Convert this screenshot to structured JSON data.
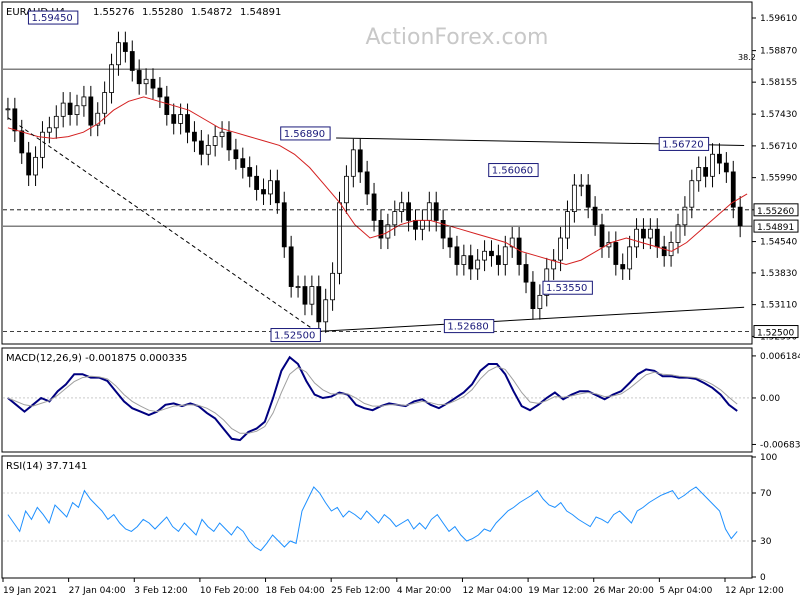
{
  "chart_data": [
    {
      "type": "candlestick",
      "header": {
        "symbol": "EURAUD,H4",
        "open": "1.55276",
        "high": "1.55280",
        "low": "1.54872",
        "close": "1.54891"
      },
      "watermark": "ActionForex.com",
      "y_axis_ticks": [
        "1.59610",
        "1.58870",
        "1.58155",
        "1.57430",
        "1.56710",
        "1.55990",
        "1.55260",
        "1.54540",
        "1.53830",
        "1.53110",
        "1.52390"
      ],
      "ylim": [
        1.5224,
        1.5995
      ],
      "price_boxes": [
        {
          "label": "1.55260",
          "value": 1.5526,
          "bg": "#ffffff",
          "fg": "#000000"
        },
        {
          "label": "1.54891",
          "value": 1.54891,
          "bg": "#ffffff",
          "fg": "#000000"
        },
        {
          "label": "1.52500",
          "value": 1.525,
          "bg": "#ffffff",
          "fg": "#000000"
        }
      ],
      "fib_label": "38.2",
      "fib_level": 1.5845,
      "annotations": [
        {
          "text": "1.59450",
          "value": 1.5945,
          "bar": 80
        },
        {
          "text": "1.56890",
          "value": 1.5689,
          "bar": 338
        },
        {
          "text": "1.56060",
          "value": 1.5606,
          "bar": 545
        },
        {
          "text": "1.56720",
          "value": 1.5672,
          "bar": 718
        },
        {
          "text": "1.53550",
          "value": 1.5355,
          "bar": 596
        },
        {
          "text": "1.52680",
          "value": 1.5268,
          "bar": 500
        },
        {
          "text": "1.52500",
          "value": 1.525,
          "bar": 318
        }
      ],
      "lines": [
        {
          "kind": "solid",
          "from": [
            338,
            1.5689
          ],
          "to": [
            752,
            1.5672
          ]
        },
        {
          "kind": "solid",
          "from": [
            318,
            1.525
          ],
          "to": [
            752,
            1.5305
          ]
        },
        {
          "kind": "dashed",
          "from": [
            5,
            1.5735
          ],
          "to": [
            318,
            1.525
          ]
        },
        {
          "kind": "dashed-h",
          "value": 1.5526
        },
        {
          "kind": "solid-h",
          "value": 1.5845
        },
        {
          "kind": "solid-h",
          "value": 1.5489
        },
        {
          "kind": "dashed-h",
          "value": 1.525
        }
      ],
      "close_series": [
        1.5755,
        1.5705,
        1.5655,
        1.5605,
        1.5645,
        1.5702,
        1.5712,
        1.5738,
        1.5768,
        1.5742,
        1.5762,
        1.5782,
        1.5718,
        1.5745,
        1.5792,
        1.5855,
        1.5905,
        1.5885,
        1.5842,
        1.5812,
        1.5822,
        1.5802,
        1.5782,
        1.5742,
        1.5722,
        1.5742,
        1.5702,
        1.5682,
        1.5652,
        1.5672,
        1.5692,
        1.5702,
        1.5662,
        1.5642,
        1.5622,
        1.5602,
        1.5572,
        1.5562,
        1.5592,
        1.5542,
        1.5442,
        1.5352,
        1.5352,
        1.5312,
        1.5352,
        1.5272,
        1.5322,
        1.5382,
        1.5542,
        1.5602,
        1.5662,
        1.5612,
        1.5562,
        1.5502,
        1.5462,
        1.5492,
        1.5522,
        1.5542,
        1.5502,
        1.5482,
        1.5502,
        1.5542,
        1.5502,
        1.5462,
        1.5442,
        1.5402,
        1.5422,
        1.5392,
        1.5412,
        1.5432,
        1.5422,
        1.5402,
        1.5442,
        1.5462,
        1.5402,
        1.5362,
        1.5302,
        1.5332,
        1.5392,
        1.5412,
        1.5462,
        1.5522,
        1.5582,
        1.5582,
        1.5532,
        1.5492,
        1.5442,
        1.5452,
        1.5402,
        1.5392,
        1.5442,
        1.5482,
        1.5462,
        1.5482,
        1.5442,
        1.5422,
        1.5452,
        1.5492,
        1.5532,
        1.5592,
        1.5622,
        1.5602,
        1.5652,
        1.5632,
        1.5612,
        1.5532,
        1.5489
      ],
      "ma_series": [
        1.5712,
        1.5702,
        1.5692,
        1.5688,
        1.5692,
        1.5702,
        1.5722,
        1.5752,
        1.5772,
        1.5782,
        1.5772,
        1.5762,
        1.5752,
        1.5732,
        1.5712,
        1.5702,
        1.5692,
        1.5682,
        1.5672,
        1.5652,
        1.5622,
        1.5582,
        1.5542,
        1.5492,
        1.5462,
        1.5472,
        1.5492,
        1.5502,
        1.5502,
        1.5492,
        1.5482,
        1.5472,
        1.5462,
        1.5452,
        1.5432,
        1.5422,
        1.5412,
        1.5402,
        1.5412,
        1.5432,
        1.5452,
        1.5462,
        1.5452,
        1.5442,
        1.5432,
        1.5452,
        1.5482,
        1.5512,
        1.5542,
        1.5562
      ],
      "ma_color": "#d42020",
      "candle_color": "#000000"
    },
    {
      "type": "line",
      "label": "MACD(12,26,9) -0.001875 0.000335",
      "y_axis_ticks": [
        "0.006184",
        "0.00",
        "-0.006837"
      ],
      "ylim": [
        -0.0078,
        0.0072
      ],
      "series": [
        {
          "role": "macd",
          "color": "#000080",
          "values": [
            0.0,
            -0.001,
            -0.002,
            -0.001,
            0.0,
            -0.0005,
            0.001,
            0.002,
            0.0035,
            0.0035,
            0.003,
            0.003,
            0.0025,
            0.001,
            -0.0005,
            -0.0015,
            -0.002,
            -0.0025,
            -0.002,
            -0.001,
            -0.0008,
            -0.0012,
            -0.0008,
            -0.0012,
            -0.0022,
            -0.003,
            -0.0045,
            -0.006,
            -0.0062,
            -0.005,
            -0.0045,
            -0.0035,
            0.0,
            0.004,
            0.006,
            0.005,
            0.0025,
            0.0005,
            0.0,
            0.0002,
            0.0008,
            0.0005,
            -0.001,
            -0.0015,
            -0.0018,
            -0.0012,
            -0.0008,
            -0.001,
            -0.0012,
            -0.0005,
            -0.0002,
            -0.001,
            -0.0015,
            -0.0008,
            0.0,
            0.0008,
            0.002,
            0.004,
            0.005,
            0.005,
            0.0035,
            0.001,
            -0.0012,
            -0.0018,
            -0.001,
            0.0,
            0.0008,
            -0.0002,
            0.0005,
            0.001,
            0.001,
            0.0004,
            -0.0002,
            0.0005,
            0.001,
            0.0022,
            0.0035,
            0.0042,
            0.004,
            0.0032,
            0.0032,
            0.003,
            0.003,
            0.0028,
            0.0022,
            0.0015,
            0.0005,
            -0.001,
            -0.0019
          ]
        },
        {
          "role": "signal",
          "color": "#a0a0a0",
          "values": [
            0.0,
            -0.0005,
            -0.001,
            -0.0012,
            -0.0008,
            -0.0004,
            0.0004,
            0.0014,
            0.0024,
            0.003,
            0.0032,
            0.0031,
            0.0028,
            0.0018,
            0.0005,
            -0.0005,
            -0.0012,
            -0.0018,
            -0.002,
            -0.0016,
            -0.0012,
            -0.0011,
            -0.001,
            -0.0011,
            -0.0015,
            -0.0022,
            -0.0032,
            -0.0045,
            -0.0052,
            -0.0052,
            -0.0049,
            -0.0042,
            -0.0022,
            0.0008,
            0.0035,
            0.0045,
            0.0038,
            0.0022,
            0.0012,
            0.0006,
            0.0006,
            0.0006,
            0.0,
            -0.0008,
            -0.0012,
            -0.0012,
            -0.001,
            -0.001,
            -0.0011,
            -0.0008,
            -0.0005,
            -0.0007,
            -0.001,
            -0.0009,
            -0.0004,
            0.0002,
            0.0012,
            0.0028,
            0.004,
            0.0046,
            0.0042,
            0.0026,
            0.0008,
            -0.0006,
            -0.0008,
            -0.0004,
            0.0002,
            0.0001,
            0.0003,
            0.0006,
            0.0008,
            0.0006,
            0.0002,
            0.0003,
            0.0006,
            0.0014,
            0.0024,
            0.0034,
            0.0038,
            0.0035,
            0.0034,
            0.0032,
            0.0031,
            0.003,
            0.0026,
            0.002,
            0.0012,
            0.0001,
            -0.0009
          ]
        }
      ]
    },
    {
      "type": "line",
      "label": "RSI(14) 37.7141",
      "y_axis_ticks": [
        "100",
        "70",
        "30",
        "0"
      ],
      "ylim": [
        0,
        100
      ],
      "guides": [
        70,
        30
      ],
      "series": [
        {
          "role": "rsi",
          "color": "#1e90ff",
          "values": [
            52,
            45,
            38,
            55,
            48,
            58,
            52,
            45,
            60,
            55,
            50,
            62,
            58,
            72,
            65,
            60,
            55,
            48,
            52,
            45,
            40,
            38,
            42,
            48,
            45,
            40,
            45,
            50,
            42,
            38,
            45,
            40,
            35,
            48,
            42,
            38,
            45,
            40,
            35,
            42,
            38,
            30,
            25,
            22,
            28,
            35,
            30,
            25,
            30,
            28,
            55,
            65,
            75,
            70,
            62,
            55,
            58,
            50,
            55,
            52,
            48,
            55,
            50,
            45,
            52,
            48,
            42,
            45,
            48,
            40,
            45,
            40,
            48,
            52,
            45,
            38,
            42,
            35,
            30,
            32,
            35,
            40,
            38,
            45,
            50,
            55,
            58,
            62,
            65,
            68,
            72,
            65,
            60,
            58,
            62,
            55,
            52,
            48,
            45,
            42,
            50,
            48,
            45,
            52,
            55,
            50,
            45,
            55,
            58,
            62,
            65,
            68,
            70,
            72,
            65,
            68,
            72,
            75,
            70,
            65,
            60,
            55,
            40,
            32,
            38
          ]
        }
      ]
    }
  ],
  "x_axis": {
    "labels": [
      "19 Jan 2021",
      "27 Jan 04:00",
      "3 Feb 12:00",
      "10 Feb 20:00",
      "18 Feb 04:00",
      "25 Feb 12:00",
      "4 Mar 20:00",
      "12 Mar 04:00",
      "19 Mar 12:00",
      "26 Mar 20:00",
      "5 Apr 04:00",
      "12 Apr 12:00"
    ]
  }
}
